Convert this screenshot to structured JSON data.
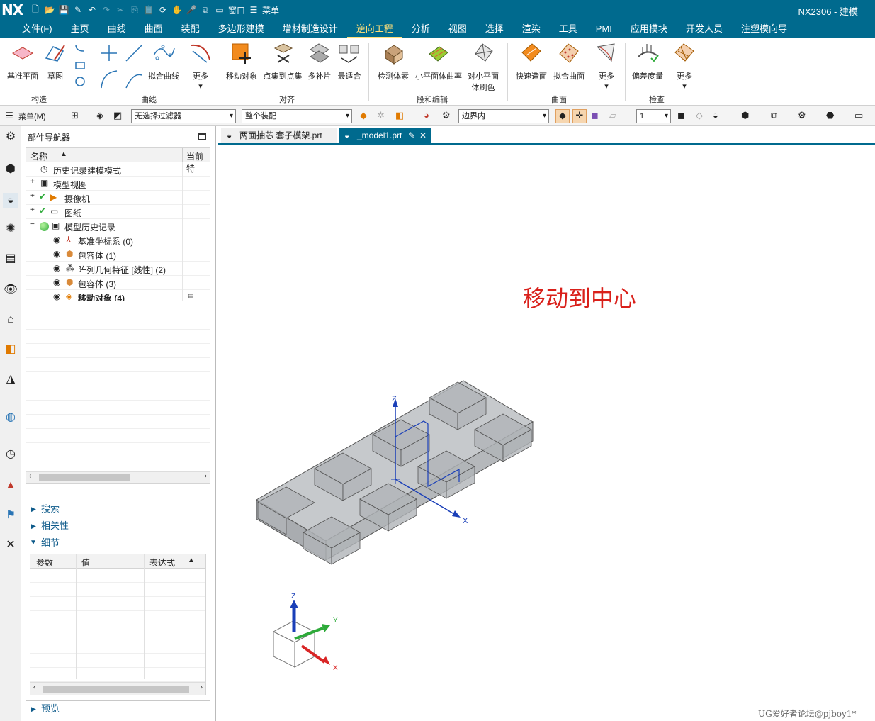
{
  "titlebar": {
    "logo": "NX",
    "window_menu": "窗口",
    "menu": "菜单",
    "app_title": "NX2306 - 建模"
  },
  "menubar": [
    "文件(F)",
    "主页",
    "曲线",
    "曲面",
    "装配",
    "多边形建模",
    "增材制造设计",
    "逆向工程",
    "分析",
    "视图",
    "选择",
    "渲染",
    "工具",
    "PMI",
    "应用模块",
    "开发人员",
    "注塑模向导"
  ],
  "active_menu": "逆向工程",
  "ribbon": {
    "buttons": [
      "基准平面",
      "草图",
      "拟合曲线",
      "更多",
      "移动对象",
      "点集到点集",
      "多补片",
      "最适合",
      "检测体素",
      "小平面体曲率",
      "对小平面",
      "体刷色",
      "快速造面",
      "拟合曲面",
      "更多",
      "偏差度量",
      "更多"
    ],
    "groups": [
      "构造",
      "曲线",
      "对齐",
      "段和编辑",
      "曲面",
      "检查"
    ]
  },
  "toolbar2": {
    "menu": "菜单(M)",
    "filter": "无选择过滤器",
    "scope": "整个装配",
    "boundary": "边界内",
    "layer": "1"
  },
  "navigator": {
    "title": "部件导航器",
    "columns": [
      "名称",
      "当前特"
    ],
    "items": [
      {
        "label": "历史记录建模模式"
      },
      {
        "label": "模型视图"
      },
      {
        "label": "摄像机"
      },
      {
        "label": "图纸"
      },
      {
        "label": "模型历史记录"
      },
      {
        "label": "基准坐标系 (0)"
      },
      {
        "label": "包容体 (1)"
      },
      {
        "label": "阵列几何特征 [线性] (2)"
      },
      {
        "label": "包容体 (3)"
      },
      {
        "label": "移动对象 (4)"
      }
    ],
    "sections": [
      "搜索",
      "相关性",
      "细节",
      "预览"
    ],
    "details_columns": [
      "参数",
      "值",
      "表达式"
    ]
  },
  "tabs": [
    {
      "label": "两面抽芯 套子模架.prt"
    },
    {
      "label": "_model1.prt"
    }
  ],
  "viewport": {
    "annotation": "移动到中心",
    "axis_z": "Z",
    "axis_x": "X",
    "axis_y": "Y",
    "watermark": "UG爱好者论坛@pjboy1*"
  },
  "colors": {
    "brand": "#006a8e",
    "active_menu": "#ffe07a",
    "annotation": "#d9201a"
  }
}
